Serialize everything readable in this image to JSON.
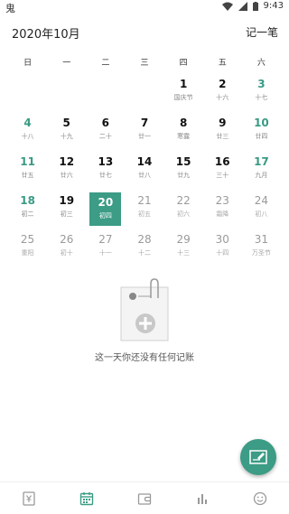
{
  "statusbar": {
    "app_glyph": "鬼",
    "time": "9:43",
    "icons": [
      "wifi-icon",
      "signal-icon",
      "battery-icon"
    ]
  },
  "header": {
    "month_title": "2020年10月",
    "action_label": "记一笔"
  },
  "weekdays": [
    "日",
    "一",
    "二",
    "三",
    "四",
    "五",
    "六"
  ],
  "calendar": {
    "selected_day": 20,
    "accent_color": "#3c9c85",
    "cells": [
      {
        "day": "",
        "lunar": ""
      },
      {
        "day": "",
        "lunar": ""
      },
      {
        "day": "",
        "lunar": ""
      },
      {
        "day": "",
        "lunar": ""
      },
      {
        "day": "1",
        "lunar": "国庆节"
      },
      {
        "day": "2",
        "lunar": "十六"
      },
      {
        "day": "3",
        "lunar": "十七"
      },
      {
        "day": "4",
        "lunar": "十八"
      },
      {
        "day": "5",
        "lunar": "十九"
      },
      {
        "day": "6",
        "lunar": "二十"
      },
      {
        "day": "7",
        "lunar": "廿一"
      },
      {
        "day": "8",
        "lunar": "寒露"
      },
      {
        "day": "9",
        "lunar": "廿三"
      },
      {
        "day": "10",
        "lunar": "廿四"
      },
      {
        "day": "11",
        "lunar": "廿五"
      },
      {
        "day": "12",
        "lunar": "廿六"
      },
      {
        "day": "13",
        "lunar": "廿七"
      },
      {
        "day": "14",
        "lunar": "廿八"
      },
      {
        "day": "15",
        "lunar": "廿九"
      },
      {
        "day": "16",
        "lunar": "三十"
      },
      {
        "day": "17",
        "lunar": "九月"
      },
      {
        "day": "18",
        "lunar": "初二"
      },
      {
        "day": "19",
        "lunar": "初三"
      },
      {
        "day": "20",
        "lunar": "初四"
      },
      {
        "day": "21",
        "lunar": "初五"
      },
      {
        "day": "22",
        "lunar": "初六"
      },
      {
        "day": "23",
        "lunar": "霜降"
      },
      {
        "day": "24",
        "lunar": "初八"
      },
      {
        "day": "25",
        "lunar": "重阳"
      },
      {
        "day": "26",
        "lunar": "初十"
      },
      {
        "day": "27",
        "lunar": "十一"
      },
      {
        "day": "28",
        "lunar": "十二"
      },
      {
        "day": "29",
        "lunar": "十三"
      },
      {
        "day": "30",
        "lunar": "十四"
      },
      {
        "day": "31",
        "lunar": "万圣节"
      }
    ]
  },
  "empty_state": {
    "message": "这一天你还没有任何记账",
    "icon": "notepad-add-icon"
  },
  "fab": {
    "icon": "edit-note-icon"
  },
  "bottom_nav": [
    {
      "icon": "yen-icon"
    },
    {
      "icon": "calendar-icon",
      "active": true
    },
    {
      "icon": "wallet-icon"
    },
    {
      "icon": "bar-chart-icon"
    },
    {
      "icon": "smiley-icon"
    }
  ]
}
